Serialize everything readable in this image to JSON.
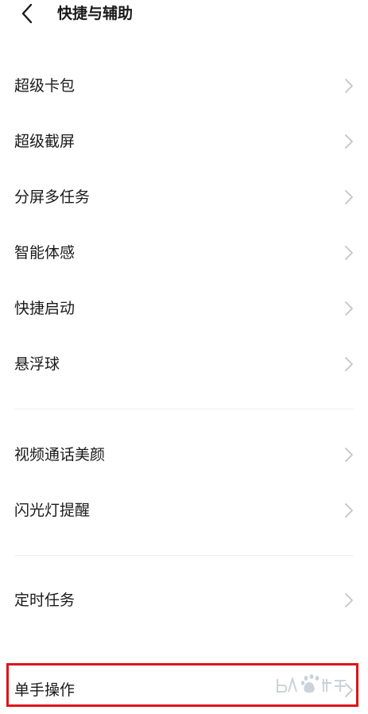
{
  "header": {
    "back_icon": "chevron-left-icon",
    "title": "快捷与辅助"
  },
  "groups": [
    {
      "items": [
        {
          "label": "超级卡包"
        },
        {
          "label": "超级截屏"
        },
        {
          "label": "分屏多任务"
        },
        {
          "label": "智能体感"
        },
        {
          "label": "快捷启动"
        },
        {
          "label": "悬浮球"
        }
      ]
    },
    {
      "items": [
        {
          "label": "视频通话美颜"
        },
        {
          "label": "闪光灯提醒"
        }
      ]
    },
    {
      "items": [
        {
          "label": "定时任务"
        }
      ]
    },
    {
      "items": [
        {
          "label": "单手操作",
          "highlighted": true
        }
      ]
    }
  ],
  "colors": {
    "highlight": "#e0121b",
    "chevron": "#c4c4c4",
    "divider": "#efefef"
  },
  "watermark": {
    "logo": "baidu-paw-logo"
  }
}
